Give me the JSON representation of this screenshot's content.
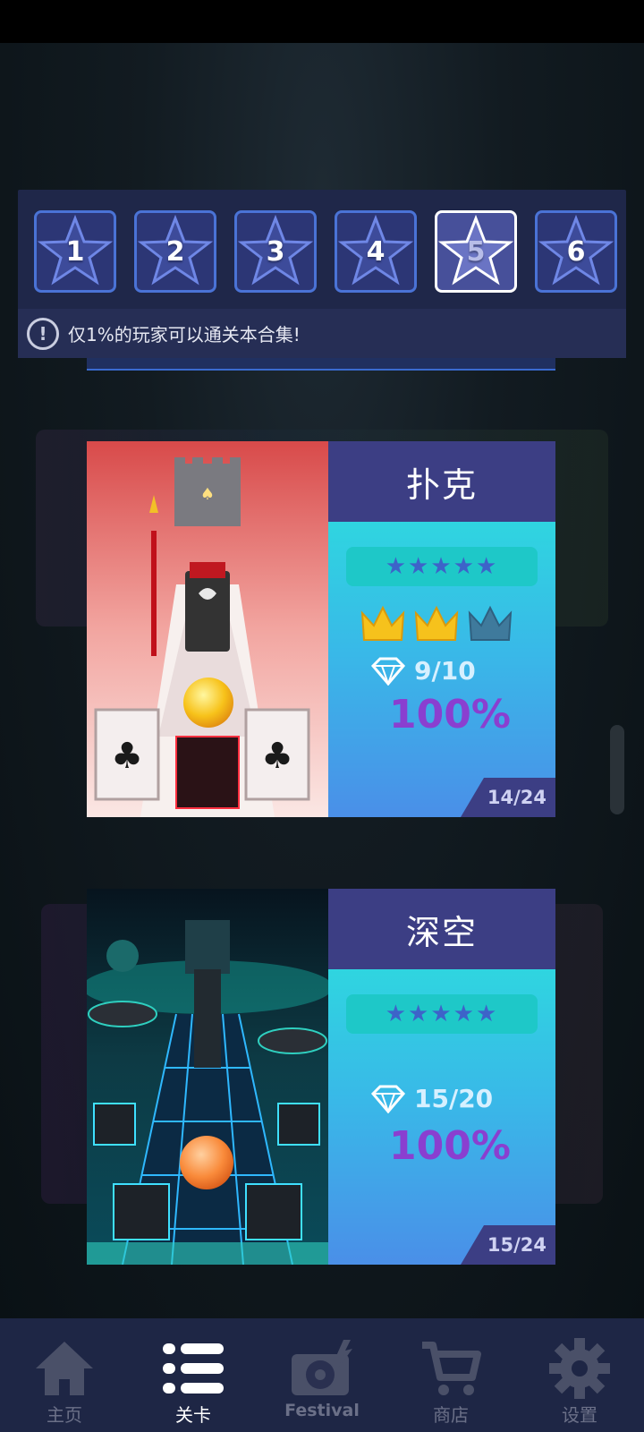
{
  "collections": {
    "tiles": [
      {
        "label": "1",
        "selected": false
      },
      {
        "label": "2",
        "selected": false
      },
      {
        "label": "3",
        "selected": false
      },
      {
        "label": "4",
        "selected": false
      },
      {
        "label": "5",
        "selected": true
      },
      {
        "label": "6",
        "selected": false
      }
    ],
    "notice_icon": "!",
    "notice_text": "仅1%的玩家可以通关本合集!"
  },
  "levels": [
    {
      "title": "扑克",
      "stars": "★★★★★",
      "crowns_earned": 2,
      "crowns_total": 3,
      "gems": "9/10",
      "percent": "100%",
      "progress": "14/24",
      "art_icon": "poker-level-art"
    },
    {
      "title": "深空",
      "stars": "★★★★★",
      "gems": "15/20",
      "percent": "100%",
      "progress": "15/24",
      "art_icon": "deep-space-level-art"
    }
  ],
  "nav": {
    "items": [
      {
        "label": "主页",
        "icon": "home-icon",
        "active": false
      },
      {
        "label": "关卡",
        "icon": "list-icon",
        "active": true
      },
      {
        "label": "Festival",
        "icon": "festival-icon",
        "active": false
      },
      {
        "label": "商店",
        "icon": "cart-icon",
        "active": false
      },
      {
        "label": "设置",
        "icon": "gear-icon",
        "active": false
      }
    ]
  },
  "colors": {
    "accent_blue": "#4a73d6",
    "info_header": "#3c3e84",
    "percent_purple": "#8a3fd0",
    "crown_gold": "#f6c21c"
  }
}
